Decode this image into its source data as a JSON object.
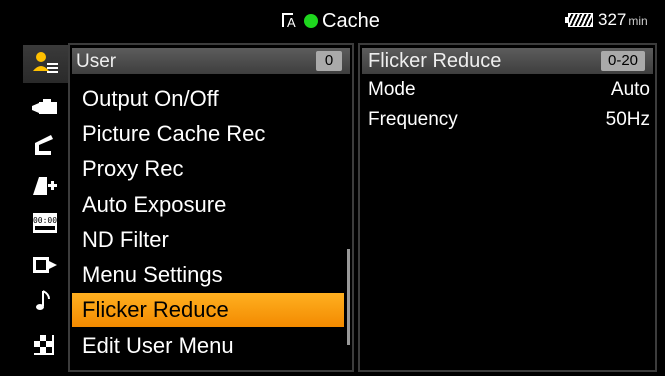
{
  "topbar": {
    "title": "Cache",
    "remaining_time": "327",
    "remaining_unit": "min",
    "icons": [
      "cache-a-icon",
      "recording-dot-icon",
      "battery-icon"
    ],
    "rec_indicator_color": "#1ed61e"
  },
  "categories": [
    {
      "name": "user-menu-icon",
      "active": true
    },
    {
      "name": "camera-icon",
      "active": false
    },
    {
      "name": "paint-icon",
      "active": false
    },
    {
      "name": "tc-media-icon",
      "active": false
    },
    {
      "name": "timecode-icon",
      "active": false
    },
    {
      "name": "output-icon",
      "active": false
    },
    {
      "name": "audio-note-icon",
      "active": false
    },
    {
      "name": "maintenance-icon",
      "active": false
    }
  ],
  "menu": {
    "header": "User",
    "page_badge": "0",
    "items": [
      {
        "label": "Output On/Off"
      },
      {
        "label": "Picture Cache Rec"
      },
      {
        "label": "Proxy Rec"
      },
      {
        "label": "Auto Exposure"
      },
      {
        "label": "ND Filter"
      },
      {
        "label": "Menu Settings"
      },
      {
        "label": "Flicker Reduce",
        "selected": true
      },
      {
        "label": "Edit User Menu"
      }
    ],
    "selected_color": "#f5a000"
  },
  "detail": {
    "header": "Flicker Reduce",
    "range_badge": "0-20",
    "rows": [
      {
        "name": "Mode",
        "value": "Auto"
      },
      {
        "name": "Frequency",
        "value": "50Hz"
      }
    ]
  }
}
